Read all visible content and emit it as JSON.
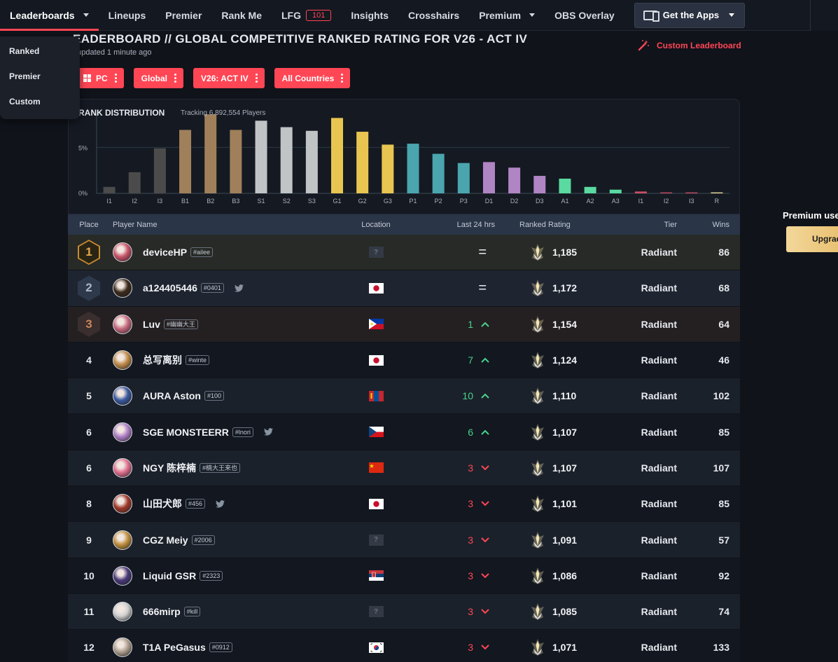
{
  "nav": {
    "items": [
      {
        "label": "Leaderboards"
      },
      {
        "label": "Lineups"
      },
      {
        "label": "Premier"
      },
      {
        "label": "Rank Me"
      },
      {
        "label": "LFG",
        "badge": "101"
      },
      {
        "label": "Insights"
      },
      {
        "label": "Crosshairs"
      },
      {
        "label": "Premium"
      },
      {
        "label": "OBS Overlay"
      }
    ],
    "get_apps": "Get the Apps"
  },
  "dropdown": [
    "Ranked",
    "Premier",
    "Custom"
  ],
  "header": {
    "title": "EADERBOARD // GLOBAL COMPETITIVE RANKED RATING FOR V26 - ACT IV",
    "updated": ": updated 1 minute ago",
    "custom_leaderboard": "Custom Leaderboard"
  },
  "filters": [
    "PC",
    "Global",
    "V26: ACT IV",
    "All Countries"
  ],
  "distribution": {
    "title": "RANK DISTRIBUTION",
    "tracking": "Tracking 6,892,554 Players",
    "ytick_5": "5%",
    "ytick_0": "0%"
  },
  "chart_data": {
    "type": "bar",
    "categories": [
      "I1",
      "I2",
      "I3",
      "B1",
      "B2",
      "B3",
      "S1",
      "S2",
      "S3",
      "G1",
      "G2",
      "G3",
      "P1",
      "P2",
      "P3",
      "D1",
      "D2",
      "D3",
      "A1",
      "A2",
      "A3",
      "I1",
      "I2",
      "I3",
      "R"
    ],
    "values": [
      0.7,
      2.3,
      4.9,
      6.9,
      8.6,
      6.9,
      7.9,
      7.2,
      6.8,
      8.2,
      6.7,
      5.3,
      5.4,
      4.3,
      3.3,
      3.4,
      2.8,
      1.9,
      1.6,
      0.7,
      0.4,
      0.2,
      0.1,
      0.1,
      0.1
    ],
    "colors": [
      "#4b4b4b",
      "#4b4b4b",
      "#4b4b4b",
      "#a0805a",
      "#a0805a",
      "#a0805a",
      "#c0c4c4",
      "#c0c4c4",
      "#c0c4c4",
      "#e8c550",
      "#e8c550",
      "#e8c550",
      "#4aa5ae",
      "#4aa5ae",
      "#4aa5ae",
      "#b085c4",
      "#b085c4",
      "#b085c4",
      "#5ad9a0",
      "#5ad9a0",
      "#5ad9a0",
      "#cc4f66",
      "#cc4f66",
      "#cc4f66",
      "#f0e4a0"
    ],
    "ylim": [
      0,
      10
    ],
    "grid": true
  },
  "table": {
    "headers": {
      "place": "Place",
      "player": "Player Name",
      "location": "Location",
      "last24": "Last 24 hrs",
      "rating": "Ranked Rating",
      "tier": "Tier",
      "wins": "Wins"
    },
    "rows": [
      {
        "place": "1",
        "name": "deviceHP",
        "tag": "#ailee",
        "twitter": false,
        "flag": "unknown",
        "change": "=",
        "dir": "same",
        "rating": "1,185",
        "tier": "Radiant",
        "wins": "86",
        "avatar": "#c8546a"
      },
      {
        "place": "2",
        "name": "a124405446",
        "tag": "#0401",
        "twitter": true,
        "flag": "jp",
        "change": "=",
        "dir": "same",
        "rating": "1,172",
        "tier": "Radiant",
        "wins": "68",
        "avatar": "#3a2a1a"
      },
      {
        "place": "3",
        "name": "Luv",
        "tag": "#幽幽大王",
        "twitter": false,
        "flag": "ph",
        "change": "1",
        "dir": "up",
        "rating": "1,154",
        "tier": "Radiant",
        "wins": "64",
        "avatar": "#c86a80"
      },
      {
        "place": "4",
        "name": "总写离别",
        "tag": "#winte",
        "twitter": false,
        "flag": "jp",
        "change": "7",
        "dir": "up",
        "rating": "1,124",
        "tier": "Radiant",
        "wins": "46",
        "avatar": "#c08a4a"
      },
      {
        "place": "5",
        "name": "AURA Aston",
        "tag": "#100",
        "twitter": false,
        "flag": "mn",
        "change": "10",
        "dir": "up",
        "rating": "1,110",
        "tier": "Radiant",
        "wins": "102",
        "avatar": "#3a5aa0"
      },
      {
        "place": "6",
        "name": "SGE MONSTEERR",
        "tag": "#lnori",
        "twitter": true,
        "flag": "cz",
        "change": "6",
        "dir": "up",
        "rating": "1,107",
        "tier": "Radiant",
        "wins": "85",
        "avatar": "#b080c8"
      },
      {
        "place": "6",
        "name": "NGY 陈梓楠",
        "tag": "#楠大王来也",
        "twitter": false,
        "flag": "cn",
        "change": "3",
        "dir": "down",
        "rating": "1,107",
        "tier": "Radiant",
        "wins": "107",
        "avatar": "#e07090"
      },
      {
        "place": "8",
        "name": "山田犬郎",
        "tag": "#456",
        "twitter": true,
        "flag": "jp",
        "change": "3",
        "dir": "down",
        "rating": "1,101",
        "tier": "Radiant",
        "wins": "85",
        "avatar": "#a03a2a"
      },
      {
        "place": "9",
        "name": "CGZ Meiy",
        "tag": "#2006",
        "twitter": false,
        "flag": "unknown",
        "change": "3",
        "dir": "down",
        "rating": "1,091",
        "tier": "Radiant",
        "wins": "57",
        "avatar": "#c09040"
      },
      {
        "place": "10",
        "name": "Liquid GSR",
        "tag": "#2323",
        "twitter": false,
        "flag": "rs",
        "change": "3",
        "dir": "down",
        "rating": "1,086",
        "tier": "Radiant",
        "wins": "92",
        "avatar": "#4a3a7a"
      },
      {
        "place": "11",
        "name": "666mirp",
        "tag": "#kill",
        "twitter": false,
        "flag": "unknown",
        "change": "3",
        "dir": "down",
        "rating": "1,085",
        "tier": "Radiant",
        "wins": "74",
        "avatar": "#d0d0d0"
      },
      {
        "place": "12",
        "name": "T1A PeGasus",
        "tag": "#0912",
        "twitter": false,
        "flag": "kr",
        "change": "3",
        "dir": "down",
        "rating": "1,071",
        "tier": "Radiant",
        "wins": "133",
        "avatar": "#b0a090"
      }
    ]
  },
  "side": {
    "premium": "Premium use",
    "upgrade": "Upgrad"
  }
}
